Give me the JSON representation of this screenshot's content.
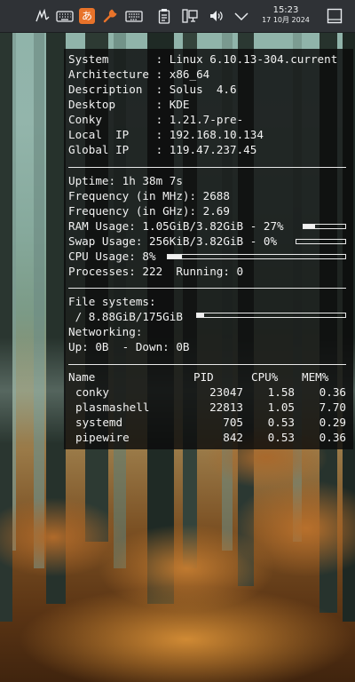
{
  "panel": {
    "clock_time": "15:23",
    "clock_date": "17 10月 2024",
    "input_method_glyph": "あ",
    "icons": [
      "handwriting-icon",
      "keyboard-icon",
      "input-method-icon",
      "wrench-icon",
      "keyboard-layout-icon",
      "clipboard-icon",
      "device-monitor-icon",
      "volume-icon",
      "expand-tray-icon",
      "show-desktop-icon"
    ]
  },
  "conky": {
    "info": [
      {
        "label": "System      ",
        "value": "Linux 6.10.13-304.current"
      },
      {
        "label": "Architecture",
        "value": "x86_64"
      },
      {
        "label": "Description ",
        "value": "Solus  4.6"
      },
      {
        "label": "Desktop     ",
        "value": "KDE"
      },
      {
        "label": "Conky       ",
        "value": "1.21.7-pre-"
      },
      {
        "label": "Local  IP   ",
        "value": "192.168.10.134"
      },
      {
        "label": "Global IP   ",
        "value": "119.47.237.45"
      }
    ],
    "uptime": "Uptime: 1h 38m 7s",
    "freq_mhz": "Frequency (in MHz): 2688",
    "freq_ghz": "Frequency (in GHz): 2.69",
    "ram": {
      "text": "RAM Usage: 1.05GiB/3.82GiB - 27%",
      "percent": 27
    },
    "swap": {
      "text": "Swap Usage: 256KiB/3.82GiB - 0%",
      "percent": 0
    },
    "cpu": {
      "text": "CPU Usage: 8%",
      "percent": 8
    },
    "processes": "Processes: 222  Running: 0",
    "fs_header": "File systems:",
    "fs_root": {
      "text": " / 8.88GiB/175GiB",
      "percent": 5
    },
    "net_header": "Networking:",
    "net": "Up: 0B  - Down: 0B",
    "proc_table": {
      "headers": [
        "Name",
        "PID",
        "CPU%",
        "MEM%"
      ],
      "rows": [
        {
          "name": "conky",
          "pid": "23047",
          "cpu": "1.58",
          "mem": "0.36"
        },
        {
          "name": "plasmashell",
          "pid": "22813",
          "cpu": "1.05",
          "mem": "7.70"
        },
        {
          "name": "systemd",
          "pid": "705",
          "cpu": "0.53",
          "mem": "0.29"
        },
        {
          "name": "pipewire",
          "pid": "842",
          "cpu": "0.53",
          "mem": "0.36"
        }
      ]
    }
  }
}
